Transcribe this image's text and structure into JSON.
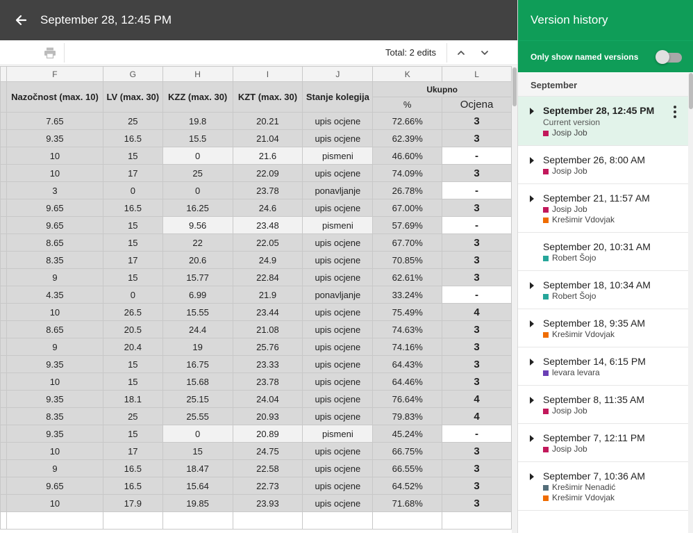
{
  "topbar": {
    "title": "September 28, 12:45 PM",
    "back_icon": "arrow-left-icon"
  },
  "toolbar": {
    "total_edits": "Total: 2 edits",
    "print_icon": "print-icon",
    "prev_icon": "chevron-up-icon",
    "next_icon": "chevron-down-icon"
  },
  "sheet": {
    "column_letters": [
      "F",
      "G",
      "H",
      "I",
      "J",
      "K",
      "L"
    ],
    "headers": {
      "F": "Nazočnost (max. 10)",
      "G": "LV (max. 30)",
      "H": "KZZ (max. 30)",
      "I": "KZT (max. 30)",
      "J": "Stanje kolegija",
      "KL": "Ukupno",
      "K": "%",
      "L": "Ocjena"
    },
    "rows": [
      [
        "7.65",
        "25",
        "19.8",
        "20.21",
        "upis ocjene",
        "72.66%",
        "3"
      ],
      [
        "9.35",
        "16.5",
        "15.5",
        "21.04",
        "upis ocjene",
        "62.39%",
        "3"
      ],
      [
        "10",
        "15",
        "0",
        "21.6",
        "pismeni",
        "46.60%",
        "-"
      ],
      [
        "10",
        "17",
        "25",
        "22.09",
        "upis ocjene",
        "74.09%",
        "3"
      ],
      [
        "3",
        "0",
        "0",
        "23.78",
        "ponavljanje",
        "26.78%",
        "-"
      ],
      [
        "9.65",
        "16.5",
        "16.25",
        "24.6",
        "upis ocjene",
        "67.00%",
        "3"
      ],
      [
        "9.65",
        "15",
        "9.56",
        "23.48",
        "pismeni",
        "57.69%",
        "-"
      ],
      [
        "8.65",
        "15",
        "22",
        "22.05",
        "upis ocjene",
        "67.70%",
        "3"
      ],
      [
        "8.35",
        "17",
        "20.6",
        "24.9",
        "upis ocjene",
        "70.85%",
        "3"
      ],
      [
        "9",
        "15",
        "15.77",
        "22.84",
        "upis ocjene",
        "62.61%",
        "3"
      ],
      [
        "4.35",
        "0",
        "6.99",
        "21.9",
        "ponavljanje",
        "33.24%",
        "-"
      ],
      [
        "10",
        "26.5",
        "15.55",
        "23.44",
        "upis ocjene",
        "75.49%",
        "4"
      ],
      [
        "8.65",
        "20.5",
        "24.4",
        "21.08",
        "upis ocjene",
        "74.63%",
        "3"
      ],
      [
        "9",
        "20.4",
        "19",
        "25.76",
        "upis ocjene",
        "74.16%",
        "3"
      ],
      [
        "9.35",
        "15",
        "16.75",
        "23.33",
        "upis ocjene",
        "64.43%",
        "3"
      ],
      [
        "10",
        "15",
        "15.68",
        "23.78",
        "upis ocjene",
        "64.46%",
        "3"
      ],
      [
        "9.35",
        "18.1",
        "25.15",
        "24.04",
        "upis ocjene",
        "76.64%",
        "4"
      ],
      [
        "8.35",
        "25",
        "25.55",
        "20.93",
        "upis ocjene",
        "79.83%",
        "4"
      ],
      [
        "9.35",
        "15",
        "0",
        "20.89",
        "pismeni",
        "45.24%",
        "-"
      ],
      [
        "10",
        "17",
        "15",
        "24.75",
        "upis ocjene",
        "66.75%",
        "3"
      ],
      [
        "9",
        "16.5",
        "18.47",
        "22.58",
        "upis ocjene",
        "66.55%",
        "3"
      ],
      [
        "9.65",
        "16.5",
        "15.64",
        "22.73",
        "upis ocjene",
        "64.52%",
        "3"
      ],
      [
        "10",
        "17.9",
        "19.85",
        "23.93",
        "upis ocjene",
        "71.68%",
        "3"
      ]
    ]
  },
  "version_panel": {
    "title": "Version history",
    "toggle_label": "Only show named versions",
    "toggle_on": false,
    "month": "September",
    "versions": [
      {
        "date": "September 28, 12:45 PM",
        "subtitle": "Current version",
        "selected": true,
        "caret": true,
        "users": [
          {
            "name": "Josip Job",
            "color": "#c2185b"
          }
        ]
      },
      {
        "date": "September 26, 8:00 AM",
        "subtitle": "",
        "selected": false,
        "caret": true,
        "users": [
          {
            "name": "Josip Job",
            "color": "#c2185b"
          }
        ]
      },
      {
        "date": "September 21, 11:57 AM",
        "subtitle": "",
        "selected": false,
        "caret": true,
        "users": [
          {
            "name": "Josip Job",
            "color": "#c2185b"
          },
          {
            "name": "Krešimir Vdovjak",
            "color": "#ef6c00"
          }
        ]
      },
      {
        "date": "September 20, 10:31 AM",
        "subtitle": "",
        "selected": false,
        "caret": false,
        "users": [
          {
            "name": "Robert Šojo",
            "color": "#26a69a"
          }
        ]
      },
      {
        "date": "September 18, 10:34 AM",
        "subtitle": "",
        "selected": false,
        "caret": true,
        "users": [
          {
            "name": "Robert Šojo",
            "color": "#26a69a"
          }
        ]
      },
      {
        "date": "September 18, 9:35 AM",
        "subtitle": "",
        "selected": false,
        "caret": true,
        "users": [
          {
            "name": "Krešimir Vdovjak",
            "color": "#ef6c00"
          }
        ]
      },
      {
        "date": "September 14, 6:15 PM",
        "subtitle": "",
        "selected": false,
        "caret": true,
        "users": [
          {
            "name": "levara levara",
            "color": "#6a3fb5"
          }
        ]
      },
      {
        "date": "September 8, 11:35 AM",
        "subtitle": "",
        "selected": false,
        "caret": true,
        "users": [
          {
            "name": "Josip Job",
            "color": "#c2185b"
          }
        ]
      },
      {
        "date": "September 7, 12:11 PM",
        "subtitle": "",
        "selected": false,
        "caret": true,
        "users": [
          {
            "name": "Josip Job",
            "color": "#c2185b"
          }
        ]
      },
      {
        "date": "September 7, 10:36 AM",
        "subtitle": "",
        "selected": false,
        "caret": true,
        "users": [
          {
            "name": "Krešimir Nenadić",
            "color": "#546e7a"
          },
          {
            "name": "Krešimir Vdovjak",
            "color": "#ef6c00"
          }
        ]
      }
    ]
  },
  "colors": {
    "topbar": "#424242",
    "panel_green": "#0f9d58",
    "selected_row": "#e2f3ea",
    "cell_gray": "#d9d9d9"
  }
}
